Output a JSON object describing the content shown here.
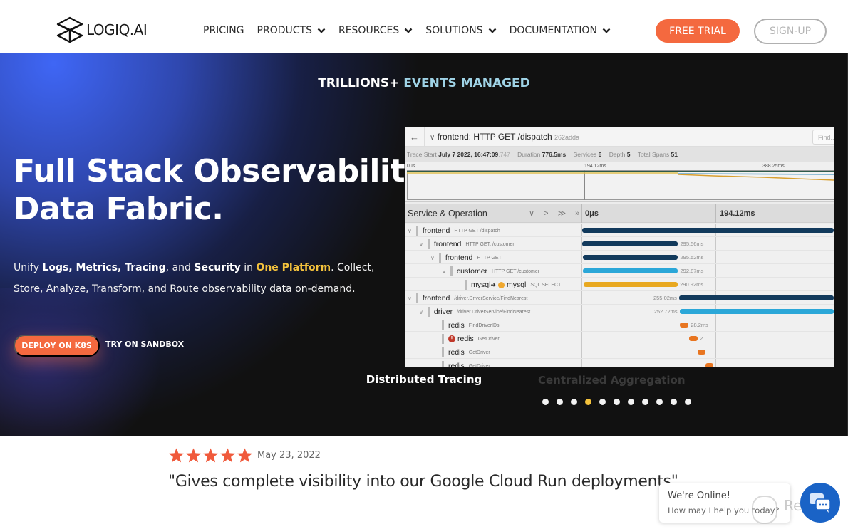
{
  "nav": {
    "logo_text": "LOGIQ.AI",
    "items": [
      {
        "label": "PRICING",
        "dropdown": false
      },
      {
        "label": "PRODUCTS",
        "dropdown": true
      },
      {
        "label": "RESOURCES",
        "dropdown": true
      },
      {
        "label": "SOLUTIONS",
        "dropdown": true
      },
      {
        "label": "DOCUMENTATION",
        "dropdown": true
      }
    ],
    "free_trial_label": "FREE TRIAL",
    "signup_label": "SIGN-UP"
  },
  "hero": {
    "tagline_white": "TRILLIONS+",
    "tagline_accent": "EVENTS MANAGED",
    "title_line1": "Full Stack Observability",
    "title_line2": "Data Fabric.",
    "sub": {
      "p1": "Unify ",
      "logs": "Logs",
      "c1": ", ",
      "metrics": "Metrics",
      "c2": ", ",
      "tracing": "Tracing",
      "c3": ", and ",
      "security": "Security",
      "c4": " in ",
      "platform": "One Platform",
      "p2": ". Collect, Store, Analyze, Transform, and Route observability data on-demand."
    },
    "deploy_label": "DEPLOY ON K8S",
    "sandbox_label": "TRY ON SANDBOX",
    "carousel_caption": "Distributed Tracing",
    "carousel_ghost": "Centralized Aggregation",
    "carousel_count": 11,
    "carousel_active_index": 3
  },
  "trace": {
    "back_icon": "arrow-left",
    "title": "frontend: HTTP GET /dispatch",
    "trace_id": "262adda",
    "find_placeholder": "Find...",
    "meta": {
      "trace_start_label": "Trace Start",
      "trace_start_value": "July 7 2022, 16:47:09",
      "trace_start_ms": ".747",
      "duration_label": "Duration",
      "duration_value": "776.5ms",
      "services_label": "Services",
      "services_value": "6",
      "depth_label": "Depth",
      "depth_value": "5",
      "spans_label": "Total Spans",
      "spans_value": "51"
    },
    "mini_ticks": [
      "0μs",
      "194.12ms",
      "388.25ms"
    ],
    "header": {
      "service_op": "Service & Operation",
      "controls": "∨ > ≫ »",
      "tick0": "0μs",
      "tick1": "194.12ms"
    },
    "rows": [
      {
        "service": "frontend",
        "op": "HTTP GET /dispatch",
        "depth": 0,
        "toggle": true,
        "color": "#123a5c",
        "start": 0.0,
        "end": 1.0,
        "duration": "",
        "label_side": "none"
      },
      {
        "service": "frontend",
        "op": "HTTP GET: /customer",
        "depth": 1,
        "toggle": true,
        "color": "#123a5c",
        "start": 0.0,
        "end": 0.381,
        "duration": "295.56ms",
        "label_side": "right"
      },
      {
        "service": "frontend",
        "op": "HTTP GET",
        "depth": 2,
        "toggle": true,
        "color": "#123a5c",
        "start": 0.002,
        "end": 0.381,
        "duration": "295.52ms",
        "label_side": "right"
      },
      {
        "service": "customer",
        "op": "HTTP GET /customer",
        "depth": 3,
        "toggle": true,
        "color": "#2ba7d8",
        "start": 0.004,
        "end": 0.381,
        "duration": "292.87ms",
        "label_side": "right"
      },
      {
        "service": "mysql",
        "op": "SQL SELECT",
        "depth": 4,
        "toggle": false,
        "color": "#e8a820",
        "start": 0.006,
        "end": 0.38,
        "duration": "290.92ms",
        "label_side": "right",
        "arrow_to": "mysql"
      },
      {
        "service": "frontend",
        "op": "/driver.DriverService/FindNearest",
        "depth": 0,
        "toggle": true,
        "color": "#123a5c",
        "start": 0.385,
        "end": 1.0,
        "duration": "255.02ms",
        "label_side": "left"
      },
      {
        "service": "driver",
        "op": "/driver.DriverService/FindNearest",
        "depth": 1,
        "toggle": true,
        "color": "#2ba7d8",
        "start": 0.387,
        "end": 1.0,
        "duration": "252.72ms",
        "label_side": "left"
      },
      {
        "service": "redis",
        "op": "FindDriverIDs",
        "depth": 2,
        "toggle": false,
        "color": "#e87520",
        "start": 0.387,
        "end": 0.423,
        "duration": "28.2ms",
        "label_side": "right"
      },
      {
        "service": "redis",
        "op": "GetDriver",
        "depth": 2,
        "toggle": false,
        "color": "#e87520",
        "start": 0.424,
        "end": 0.459,
        "duration": "2",
        "label_side": "right",
        "error": true
      },
      {
        "service": "redis",
        "op": "GetDriver",
        "depth": 2,
        "toggle": false,
        "color": "#e87520",
        "start": 0.46,
        "end": 0.49,
        "duration": "",
        "label_side": "none"
      },
      {
        "service": "redis",
        "op": "GetDriver",
        "depth": 2,
        "toggle": false,
        "color": "#e87520",
        "start": 0.49,
        "end": 0.52,
        "duration": "",
        "label_side": "none"
      }
    ]
  },
  "review": {
    "stars": 5,
    "star_color": "#f05a3c",
    "date": "May 23, 2022",
    "quote": "\"Gives complete visibility into our Google Cloud Run deployments\""
  },
  "chat": {
    "line1": "We're Online!",
    "line2": "How may I help you today?",
    "button_icon": "chat-bubbles",
    "button_color": "#1a63c6"
  },
  "watermark": "Revain",
  "colors": {
    "brand_orange": "#f4693f",
    "accent_yellow": "#f4c23c",
    "accent_cyan": "#9fd3e6",
    "hero_bg": "#111111",
    "hero_glow": "#3f66f5"
  }
}
